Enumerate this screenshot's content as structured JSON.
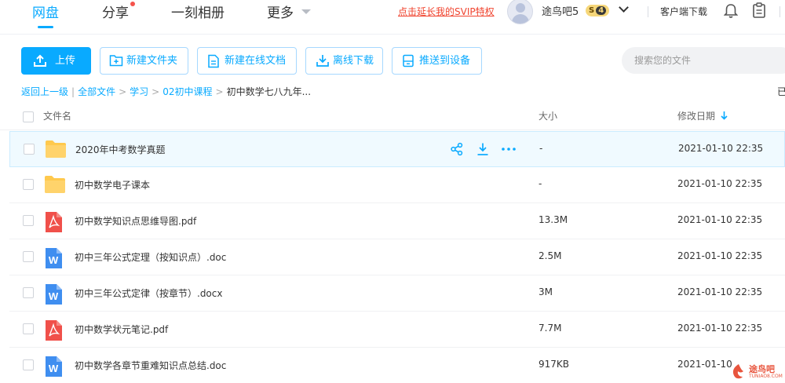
{
  "nav": {
    "tabs": [
      {
        "label": "网盘",
        "active": true
      },
      {
        "label": "分享"
      },
      {
        "label": "一刻相册"
      },
      {
        "label": "更多"
      }
    ],
    "promo": "点击延长我的SVIP特权",
    "username": "途鸟吧5",
    "vip": {
      "s": "S",
      "level": "4"
    },
    "client_download": "客户端下载"
  },
  "toolbar": {
    "upload": "上传",
    "new_folder": "新建文件夹",
    "new_online_doc": "新建在线文档",
    "offline_download": "离线下载",
    "push_to_device": "推送到设备",
    "search_placeholder": "搜索您的文件"
  },
  "breadcrumb": {
    "back": "返回上一级",
    "all_files": "全部文件",
    "level1": "学习",
    "level2": "02初中课程",
    "current": "初中数学七八九年...",
    "right_edge": "已"
  },
  "table": {
    "headers": {
      "name": "文件名",
      "size": "大小",
      "modified": "修改日期"
    },
    "rows": [
      {
        "name": "2020年中考数学真题",
        "size": "-",
        "date": "2021-01-10 22:35",
        "type": "folder"
      },
      {
        "name": "初中数学电子课本",
        "size": "-",
        "date": "2021-01-10 22:35",
        "type": "folder"
      },
      {
        "name": "初中数学知识点思维导图.pdf",
        "size": "13.3M",
        "date": "2021-01-10 22:35",
        "type": "pdf"
      },
      {
        "name": "初中三年公式定理（按知识点）.doc",
        "size": "2.5M",
        "date": "2021-01-10 22:35",
        "type": "word"
      },
      {
        "name": "初中三年公式定律（按章节）.docx",
        "size": "3M",
        "date": "2021-01-10 22:35",
        "type": "word"
      },
      {
        "name": "初中数学状元笔记.pdf",
        "size": "7.7M",
        "date": "2021-01-10 22:35",
        "type": "pdf"
      },
      {
        "name": "初中数学各章节重难知识点总结.doc",
        "size": "917KB",
        "date": "2021-01-10",
        "type": "word"
      }
    ]
  },
  "watermark": {
    "text": "途鸟吧",
    "sub": "TUNIAO8.COM"
  },
  "colors": {
    "accent": "#09aaff",
    "promo": "#f0442f",
    "pdf": "#f0504a",
    "word": "#3f8ef0",
    "folder": "#ffc94d"
  }
}
